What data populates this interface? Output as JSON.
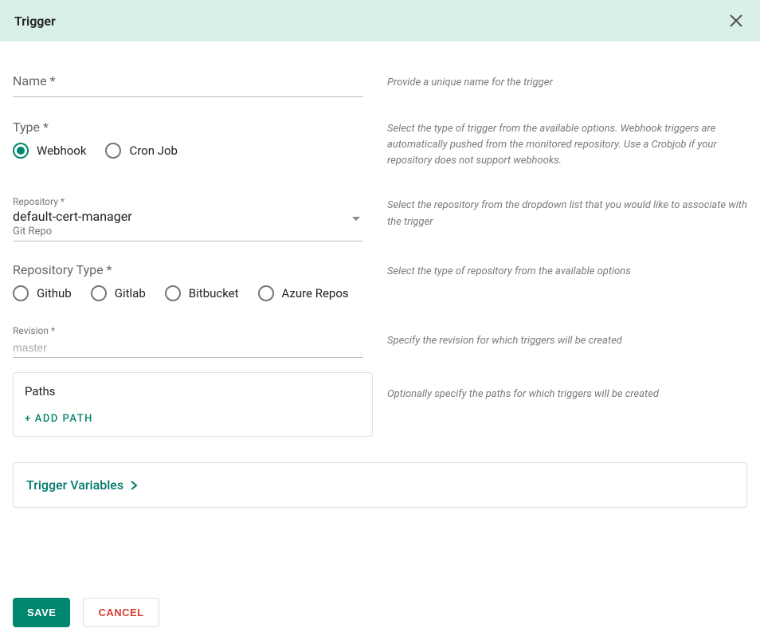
{
  "header": {
    "title": "Trigger"
  },
  "name": {
    "label": "Name *",
    "value": "",
    "hint": "Provide a unique name for the trigger"
  },
  "type": {
    "label": "Type *",
    "options": [
      {
        "label": "Webhook",
        "selected": true
      },
      {
        "label": "Cron Job",
        "selected": false
      }
    ],
    "hint": "Select the type of trigger from the available options. Webhook triggers are automatically pushed from the monitored repository. Use a Crobjob if your repository does not support webhooks."
  },
  "repository": {
    "label": "Repository *",
    "value": "default-cert-manager",
    "subvalue": "Git Repo",
    "hint": "Select the repository from the dropdown list that you would like to associate with the trigger"
  },
  "repoType": {
    "label": "Repository Type *",
    "options": [
      {
        "label": "Github",
        "selected": false
      },
      {
        "label": "Gitlab",
        "selected": false
      },
      {
        "label": "Bitbucket",
        "selected": false
      },
      {
        "label": "Azure Repos",
        "selected": false
      }
    ],
    "hint": "Select the type of repository from the available options"
  },
  "revision": {
    "label": "Revision *",
    "value": "",
    "placeholder": "master",
    "hint": "Specify the revision for which triggers will be created"
  },
  "paths": {
    "title": "Paths",
    "addLabel": "ADD  PATH",
    "hint": "Optionally specify the paths for which triggers will be created"
  },
  "triggerVars": {
    "label": "Trigger Variables"
  },
  "footer": {
    "save": "SAVE",
    "cancel": "CANCEL"
  }
}
